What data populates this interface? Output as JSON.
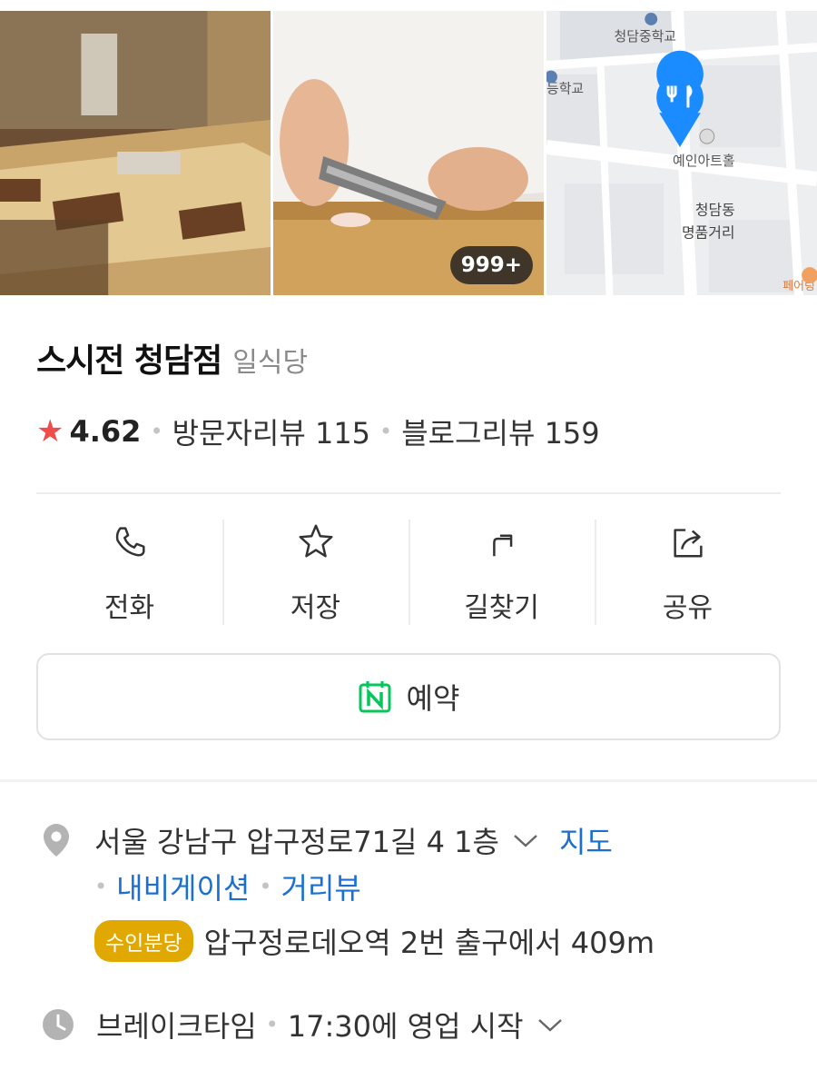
{
  "gallery": {
    "photo_count": "999+"
  },
  "map": {
    "labels": [
      "청담중학교",
      "등학교",
      "예인아트홀",
      "청담동",
      "명품거리",
      "페어링"
    ]
  },
  "place": {
    "name": "스시전 청담점",
    "category": "일식당"
  },
  "rating": {
    "value": "4.62",
    "visitor_reviews": "방문자리뷰 115",
    "blog_reviews": "블로그리뷰 159"
  },
  "actions": {
    "call": "전화",
    "save": "저장",
    "directions": "길찾기",
    "share": "공유"
  },
  "reserve": {
    "label": "예약"
  },
  "address": {
    "text": "서울 강남구 압구정로71길 4 1층",
    "map_link": "지도",
    "navigation_link": "내비게이션",
    "street_view_link": "거리뷰"
  },
  "subway": {
    "line": "수인분당",
    "description": "압구정로데오역 2번 출구에서 409m"
  },
  "hours": {
    "status": "브레이크타임",
    "detail": "17:30에 영업 시작"
  },
  "colors": {
    "star": "#f04c4c",
    "link": "#1a6fd1",
    "naver_green": "#03c75a",
    "subway_badge": "#e0a800",
    "map_pin": "#1a8cff"
  }
}
